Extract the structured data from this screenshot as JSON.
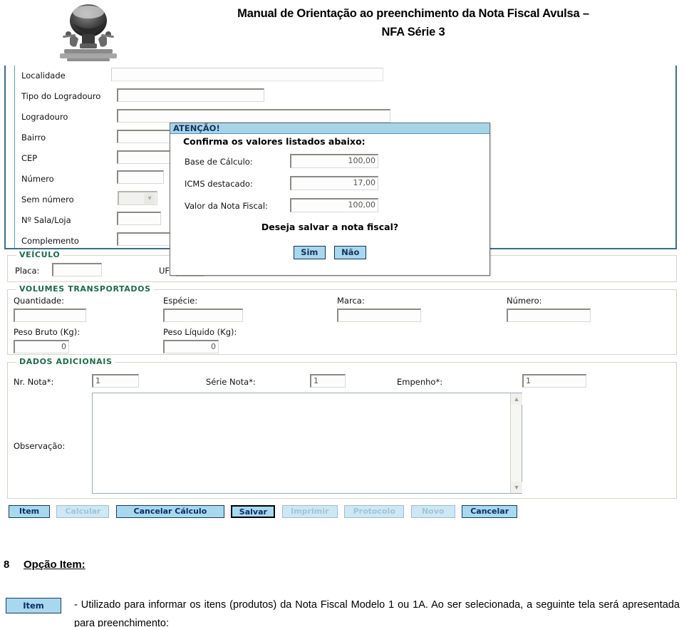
{
  "header": {
    "title_line1": "Manual de Orientação ao preenchimento da Nota Fiscal Avulsa –",
    "title_line2": "NFA Série 3",
    "logo_alt": "balloon-emblem"
  },
  "form": {
    "address_fields": [
      {
        "label": "Localidade",
        "value": ""
      },
      {
        "label": "Tipo do Logradouro",
        "value": ""
      },
      {
        "label": "Logradouro",
        "value": ""
      },
      {
        "label": "Bairro",
        "value": ""
      },
      {
        "label": "CEP",
        "value": ""
      },
      {
        "label": "Número",
        "value": ""
      },
      {
        "label": "Sem número",
        "value": ""
      },
      {
        "label": "Nº Sala/Loja",
        "value": ""
      },
      {
        "label": "Complemento",
        "value": ""
      }
    ],
    "veiculo": {
      "legend": "VEÍCULO",
      "placa_label": "Placa:",
      "placa_value": "",
      "uf_label": "UF:",
      "uf_value": ""
    },
    "volumes": {
      "legend": "VOLUMES TRANSPORTADOS",
      "quantidade_label": "Quantidade:",
      "quantidade_value": "",
      "especie_label": "Espécie:",
      "especie_value": "",
      "marca_label": "Marca:",
      "marca_value": "",
      "numero_label": "Número:",
      "numero_value": "",
      "peso_bruto_label": "Peso Bruto (Kg):",
      "peso_bruto_value": "0",
      "peso_liquido_label": "Peso Líquido (Kg):",
      "peso_liquido_value": "0"
    },
    "dados_adicionais": {
      "legend": "DADOS ADICIONAIS",
      "nr_nota_label": "Nr. Nota*:",
      "nr_nota_value": "1",
      "serie_nota_label": "Série Nota*:",
      "serie_nota_value": "1",
      "empenho_label": "Empenho*:",
      "empenho_value": "1",
      "observacao_label": "Observação:",
      "observacao_value": "",
      "scroll_up_icon": "chevron-up-icon",
      "scroll_down_icon": "chevron-down-icon"
    },
    "toolbar": [
      {
        "label": "Item",
        "state": "enabled"
      },
      {
        "label": "Calcular",
        "state": "disabled"
      },
      {
        "label": "Cancelar Cálculo",
        "state": "enabled"
      },
      {
        "label": "Salvar",
        "state": "focused"
      },
      {
        "label": "Imprimir",
        "state": "disabled"
      },
      {
        "label": "Protocolo",
        "state": "disabled"
      },
      {
        "label": "Novo",
        "state": "disabled"
      },
      {
        "label": "Cancelar",
        "state": "enabled"
      }
    ]
  },
  "modal": {
    "title": "ATENÇÃO!",
    "heading": "Confirma os valores listados abaixo:",
    "rows": [
      {
        "label": "Base de Cálculo:",
        "value": "100,00"
      },
      {
        "label": "ICMS destacado:",
        "value": "17,00"
      },
      {
        "label": "Valor da Nota Fiscal:",
        "value": "100,00"
      }
    ],
    "question": "Deseja salvar a nota fiscal?",
    "confirm_label": "Sim",
    "cancel_label": "Não"
  },
  "doc": {
    "section_number": "8",
    "section_title": "Opção Item:",
    "item_chip_label": "Item",
    "paragraph": "- Utilizado para informar os itens (produtos) da Nota Fiscal Modelo 1 ou 1A. Ao ser selecionada, a seguinte tela será apresentada para preenchimento:"
  },
  "colors": {
    "button_blue": "#a8d8ee",
    "button_text": "#0a2d66",
    "legend_green": "#1d6b4a",
    "panel_border_teal": "#3d7084",
    "modal_titlebar": "#a6d5ea"
  }
}
